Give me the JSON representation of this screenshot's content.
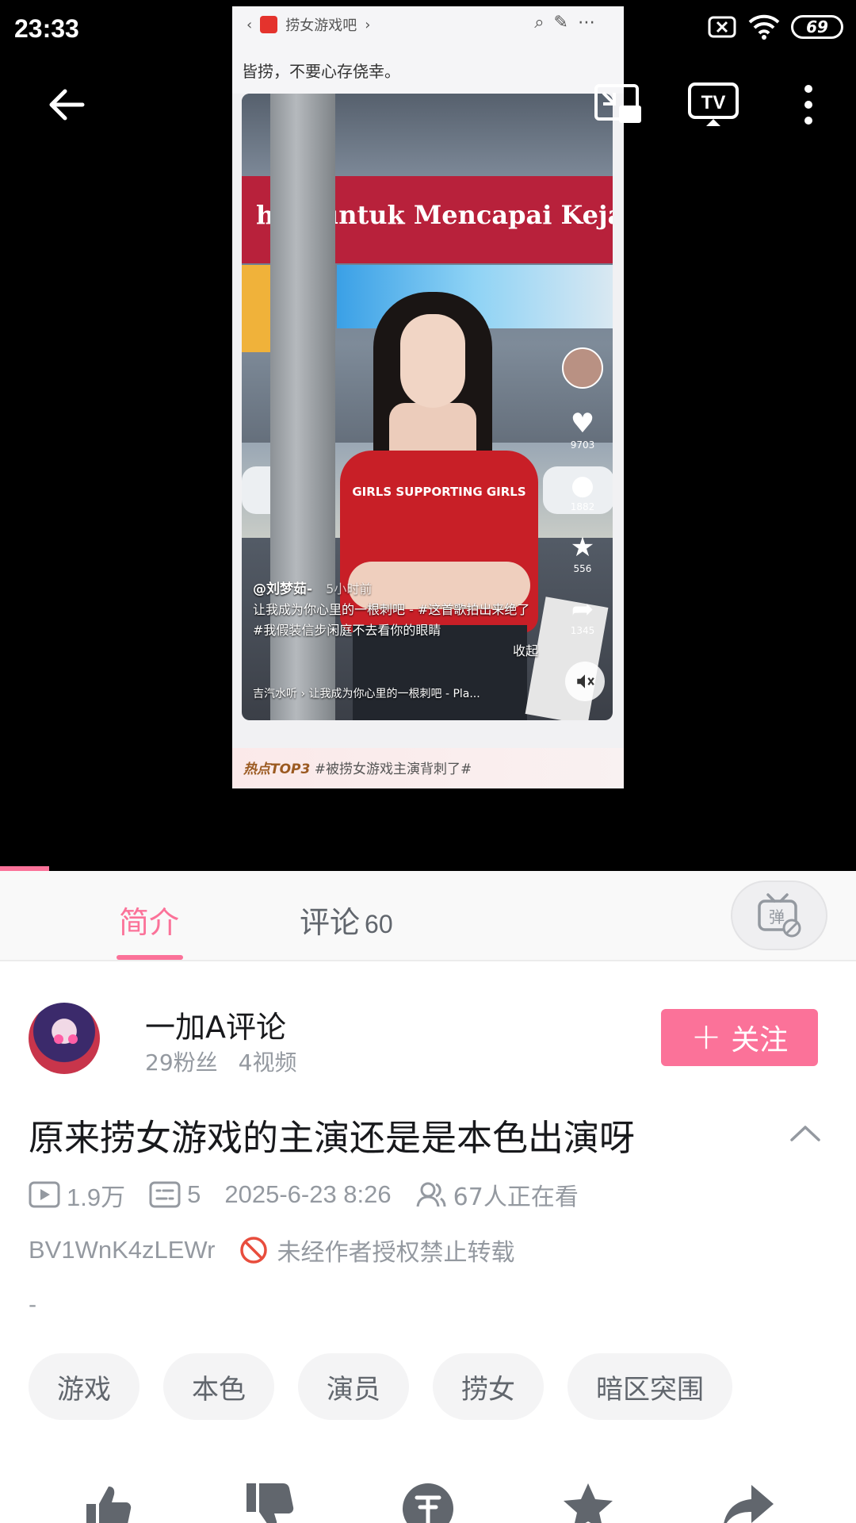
{
  "status_bar": {
    "time": "23:33",
    "battery": "69",
    "icons": [
      "sim-blocked-icon",
      "wifi-icon",
      "battery-icon"
    ]
  },
  "player": {
    "back_icon": "back-arrow-icon",
    "pip_icon": "picture-in-picture-icon",
    "cast_icon": "tv-cast-icon",
    "more_icon": "more-vertical-icon",
    "progress_fraction": 0.057
  },
  "recorded_screen": {
    "nav_title": "捞女游戏吧",
    "snippet": "皆捞，不要心存侥幸。",
    "banner_text": "h   ni untuk Mencapai Keja",
    "shirt_text": "GIRLS SUPPORTING GIRLS",
    "side_counts": {
      "likes": "9703",
      "comments": "1882",
      "stars": "556",
      "shares": "1345"
    },
    "author": "@刘梦茹-",
    "time_ago": "5小时前",
    "caption": "让我成为你心里的一根刺吧 - #这首歌拍出来绝了 #我假装信步闲庭不去看你的眼睛",
    "fold": "收起",
    "music": "吉汽水听 › 让我成为你心里的一根刺吧 - Pla...",
    "hot_label": "热点TOP3",
    "hot_topic": "#被捞女游戏主演背刺了#"
  },
  "tabs": {
    "intro": "简介",
    "comments_label": "评论",
    "comments_count": "60",
    "danmaku_icon": "danmaku-off-icon"
  },
  "uploader": {
    "name": "一加A评论",
    "fans": "29粉丝",
    "videos": "4视频",
    "follow_label": "关注"
  },
  "video": {
    "title": "原来捞女游戏的主演还是是本色出演呀",
    "views": "1.9万",
    "danmaku_count": "5",
    "date": "2025-6-23 8:26",
    "watching": "67人正在看",
    "bvid": "BV1WnK4zLEWr",
    "copyright": "未经作者授权禁止转载",
    "description": "-"
  },
  "tags": [
    "游戏",
    "本色",
    "演员",
    "捞女",
    "暗区突围"
  ],
  "actions": [
    "like-icon",
    "dislike-icon",
    "coin-icon",
    "favorite-icon",
    "share-icon"
  ],
  "colors": {
    "accent": "#fb7299",
    "text": "#18191c",
    "secondary": "#9499a0"
  }
}
